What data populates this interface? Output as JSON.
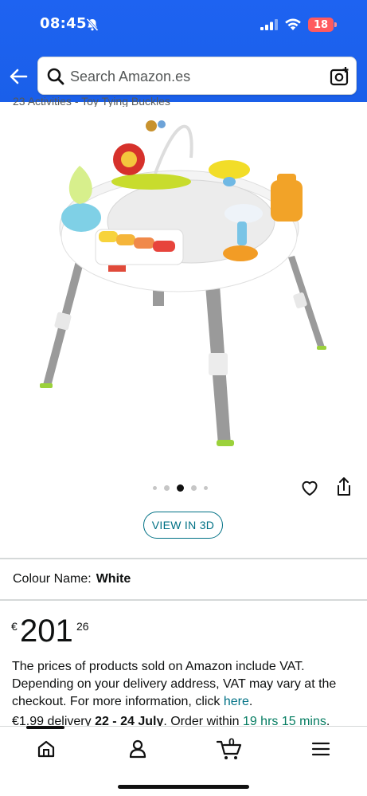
{
  "status_bar": {
    "time": "08:45",
    "battery": "18"
  },
  "search": {
    "placeholder": "Search Amazon.es"
  },
  "product": {
    "partial_subtitle": "23 Activities - Toy Tying Buckles",
    "image_dots": {
      "count": 5,
      "active_index": 2
    },
    "view_3d_label": "VIEW IN 3D",
    "colour_label": "Colour Name:",
    "colour_value": "White",
    "price": {
      "currency_symbol": "€",
      "whole": "201",
      "fraction": "26"
    },
    "vat_text": "The prices of products sold on Amazon include VAT. Depending on your delivery address, VAT may vary at the checkout. For more information, click ",
    "vat_link": "here",
    "vat_end": ".",
    "delivery": {
      "prefix": "€1.99 delivery ",
      "dates": "22 - 24 July",
      "middle": ". Order within ",
      "countdown": "19 hrs 15 mins",
      "suffix": "."
    }
  },
  "bottom_nav": {
    "cart_count": "0",
    "items": [
      "home-icon",
      "account-icon",
      "cart-icon",
      "menu-icon"
    ]
  },
  "colors": {
    "header_blue": "#1e63f1",
    "link_teal": "#007185",
    "green": "#067d62"
  }
}
